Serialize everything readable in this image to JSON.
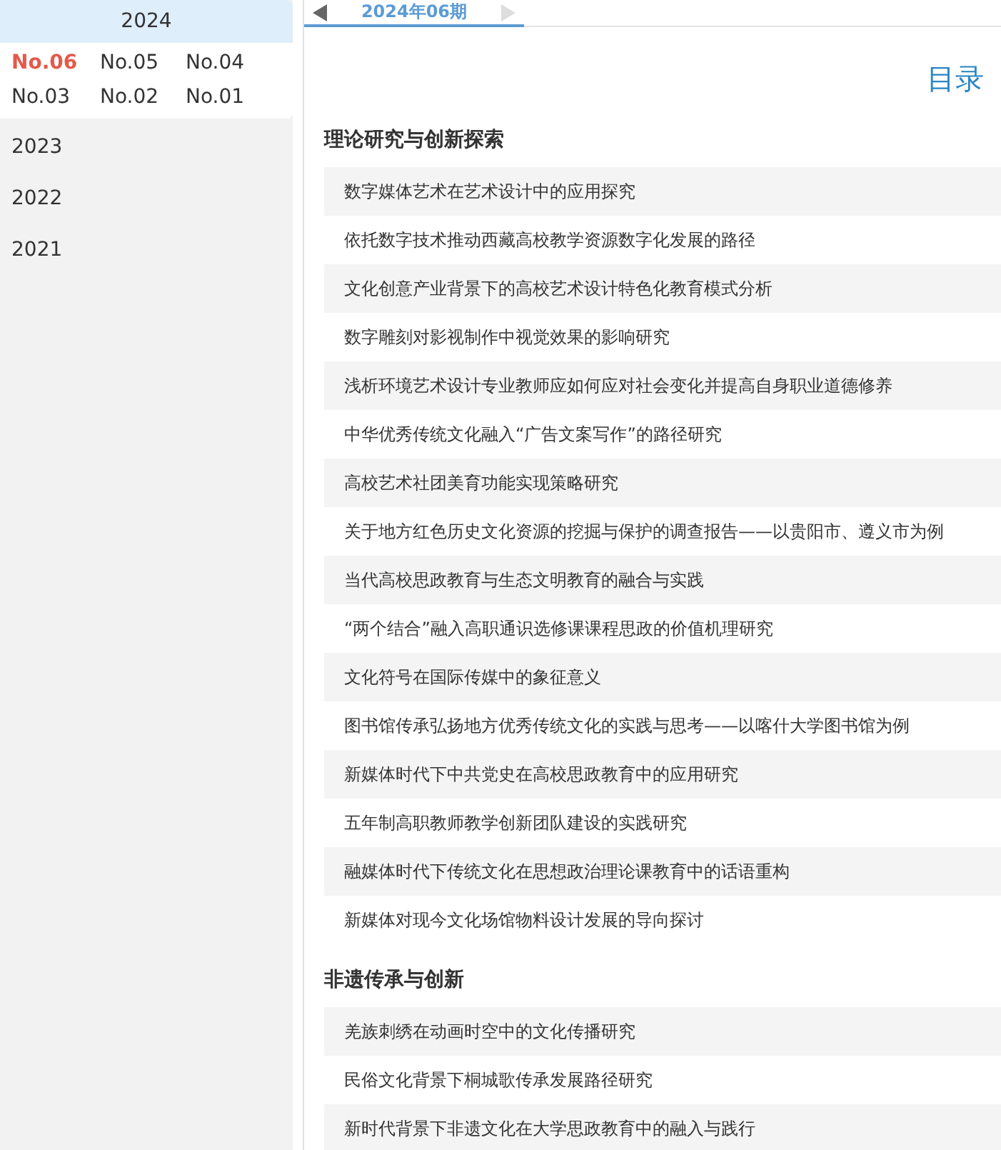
{
  "sidebar": {
    "years": [
      {
        "label": "2024",
        "expanded": true,
        "issues": [
          {
            "label": "No.06",
            "selected": true
          },
          {
            "label": "No.05",
            "selected": false
          },
          {
            "label": "No.04",
            "selected": false
          },
          {
            "label": "No.03",
            "selected": false
          },
          {
            "label": "No.02",
            "selected": false
          },
          {
            "label": "No.01",
            "selected": false
          }
        ]
      },
      {
        "label": "2023",
        "expanded": false
      },
      {
        "label": "2022",
        "expanded": false
      },
      {
        "label": "2021",
        "expanded": false
      }
    ]
  },
  "tab_bar": {
    "prev": {
      "disabled": false
    },
    "next": {
      "disabled": true
    },
    "tabs": [
      {
        "label": "2024年06期",
        "selected": true
      }
    ]
  },
  "toc": {
    "title": "目录",
    "sections": [
      {
        "heading": "理论研究与创新探索",
        "articles": [
          "数字媒体艺术在艺术设计中的应用探究",
          "依托数字技术推动西藏高校教学资源数字化发展的路径",
          "文化创意产业背景下的高校艺术设计特色化教育模式分析",
          "数字雕刻对影视制作中视觉效果的影响研究",
          "浅析环境艺术设计专业教师应如何应对社会变化并提高自身职业道德修养",
          "中华优秀传统文化融入“广告文案写作”的路径研究",
          "高校艺术社团美育功能实现策略研究",
          "关于地方红色历史文化资源的挖掘与保护的调查报告——以贵阳市、遵义市为例",
          "当代高校思政教育与生态文明教育的融合与实践",
          "“两个结合”融入高职通识选修课课程思政的价值机理研究",
          "文化符号在国际传媒中的象征意义",
          "图书馆传承弘扬地方优秀传统文化的实践与思考——以喀什大学图书馆为例",
          "新媒体时代下中共党史在高校思政教育中的应用研究",
          "五年制高职教师教学创新团队建设的实践研究",
          "融媒体时代下传统文化在思想政治理论课教育中的话语重构",
          "新媒体对现今文化场馆物料设计发展的导向探讨"
        ]
      },
      {
        "heading": "非遗传承与创新",
        "articles": [
          "羌族刺绣在动画时空中的文化传播研究",
          "民俗文化背景下桐城歌传承发展路径研究",
          "新时代背景下非遗文化在大学思政教育中的融入与践行"
        ]
      }
    ]
  }
}
